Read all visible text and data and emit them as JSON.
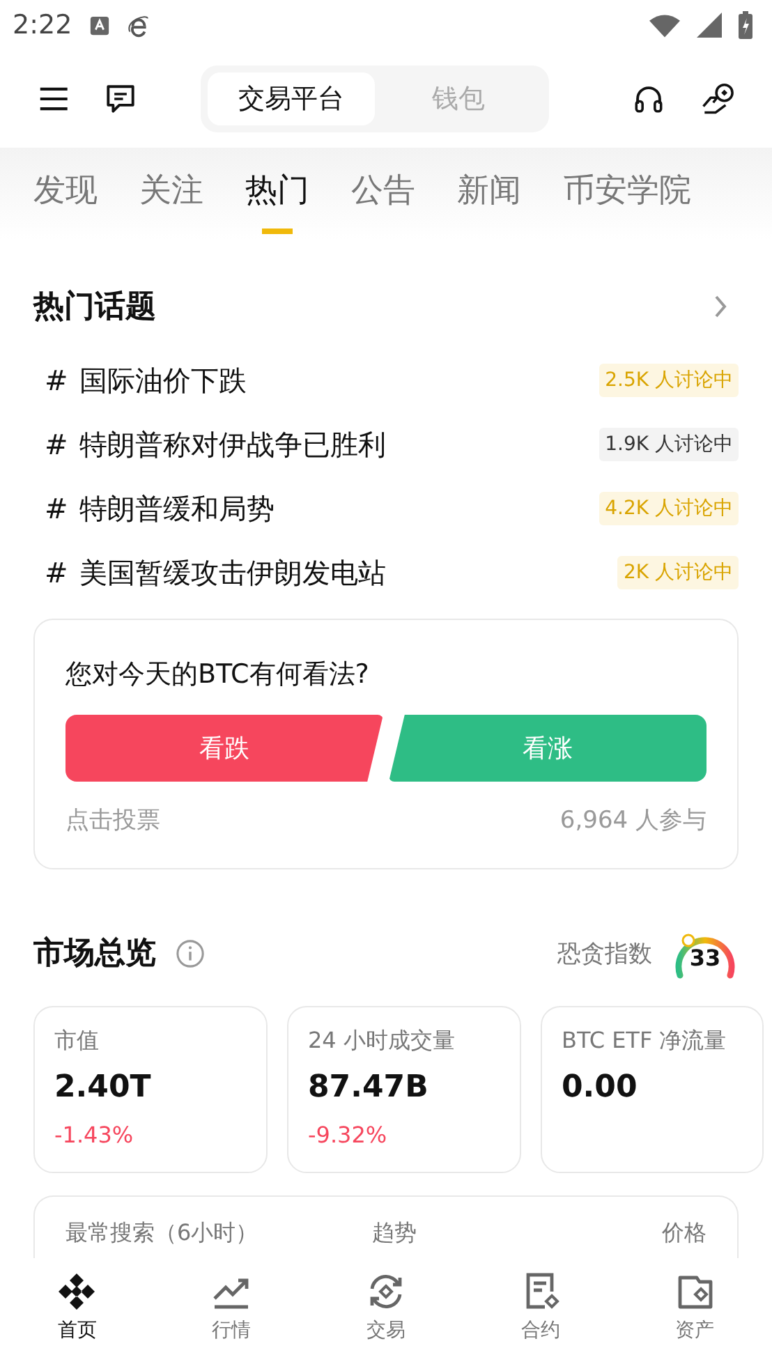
{
  "status_bar": {
    "time": "2:22"
  },
  "header": {
    "segments": [
      {
        "label": "交易平台",
        "selected": true
      },
      {
        "label": "钱包",
        "selected": false
      }
    ]
  },
  "tabs": [
    {
      "label": "发现",
      "selected": false
    },
    {
      "label": "关注",
      "selected": false
    },
    {
      "label": "热门",
      "selected": true
    },
    {
      "label": "公告",
      "selected": false
    },
    {
      "label": "新闻",
      "selected": false
    },
    {
      "label": "币安学院",
      "selected": false
    }
  ],
  "hot_topics": {
    "title": "热门话题",
    "items": [
      {
        "hash": "#",
        "title": "国际油价下跌",
        "badge": "2.5K 人讨论中",
        "hot": true
      },
      {
        "hash": "#",
        "title": "特朗普称对伊战争已胜利",
        "badge": "1.9K 人讨论中",
        "hot": false
      },
      {
        "hash": "#",
        "title": "特朗普缓和局势",
        "badge": "4.2K 人讨论中",
        "hot": true
      },
      {
        "hash": "#",
        "title": "美国暂缓攻击伊朗发电站",
        "badge": "2K 人讨论中",
        "hot": true
      }
    ]
  },
  "poll": {
    "question": "您对今天的BTC有何看法?",
    "bear": "看跌",
    "bull": "看涨",
    "hint": "点击投票",
    "participants": "6,964 人参与"
  },
  "market": {
    "title": "市场总览",
    "fear_greed_label": "恐贪指数",
    "fear_greed_value": "33",
    "cards": [
      {
        "label": "市值",
        "value": "2.40T",
        "change": "-1.43%"
      },
      {
        "label": "24 小时成交量",
        "value": "87.47B",
        "change": "-9.32%"
      },
      {
        "label": "BTC ETF 净流量",
        "value": "0.00"
      }
    ],
    "table_header": [
      "最常搜索（6小时）",
      "趋势",
      "价格"
    ]
  },
  "bottom_nav": [
    {
      "label": "首页",
      "selected": true
    },
    {
      "label": "行情",
      "selected": false
    },
    {
      "label": "交易",
      "selected": false
    },
    {
      "label": "合约",
      "selected": false
    },
    {
      "label": "资产",
      "selected": false
    }
  ]
}
